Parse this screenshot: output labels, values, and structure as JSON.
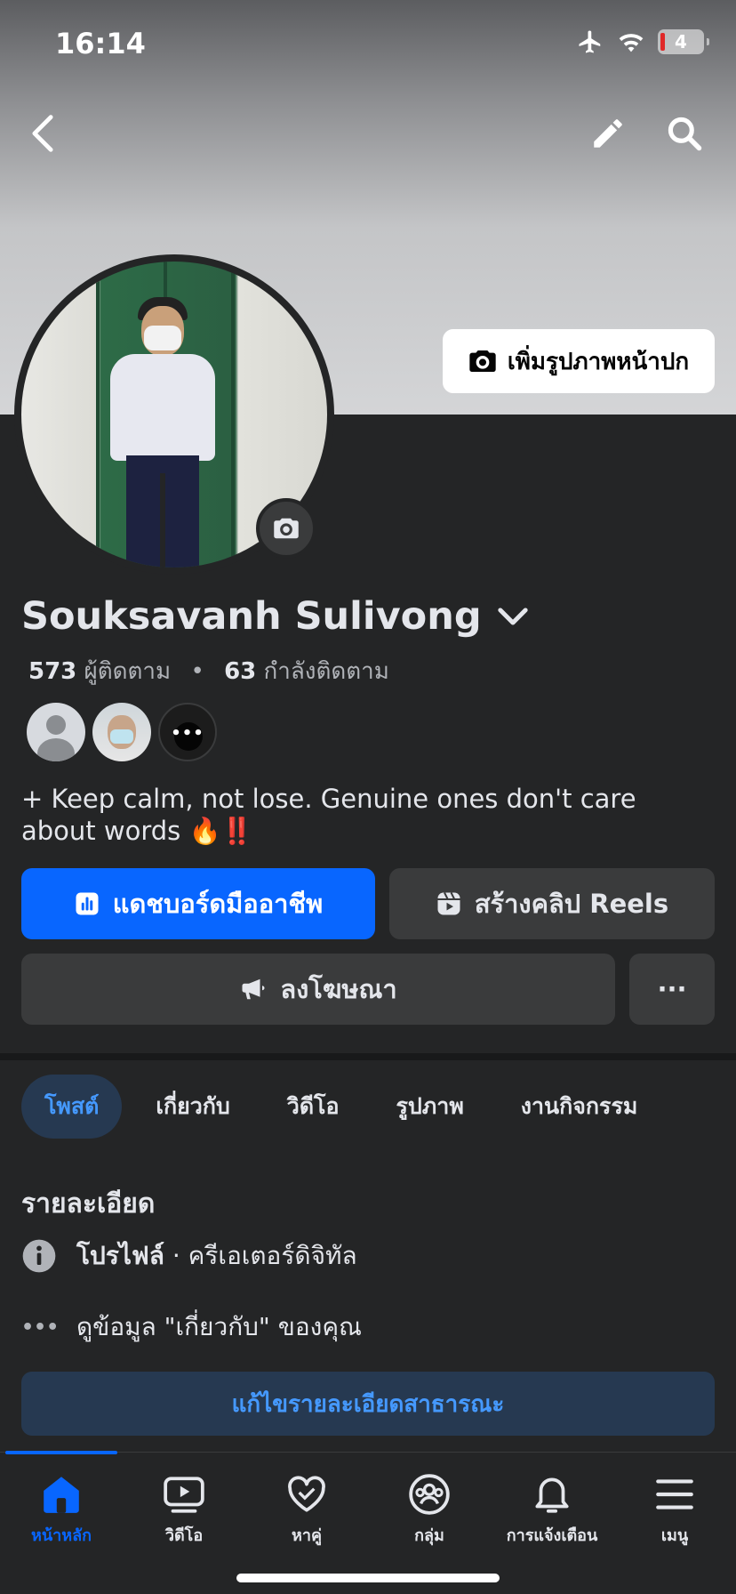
{
  "status_bar": {
    "time": "16:14",
    "battery": "4"
  },
  "cover": {
    "add_cover_label": "เพิ่มรูปภาพหน้าปก"
  },
  "profile": {
    "name": "Souksavanh Sulivong",
    "followers_count": "573",
    "followers_label": "ผู้ติดตาม",
    "following_count": "63",
    "following_label": "กำลังติดตาม",
    "bio": "+ Keep calm, not lose.  Genuine ones don't care about words 🔥‼️"
  },
  "actions": {
    "dashboard_label": "แดชบอร์ดมืออาชีพ",
    "reels_label": "สร้างคลิป Reels",
    "advertise_label": "ลงโฆษณา",
    "more_label": "···"
  },
  "tabs": [
    {
      "label": "โพสต์",
      "active": true
    },
    {
      "label": "เกี่ยวกับ",
      "active": false
    },
    {
      "label": "วิดีโอ",
      "active": false
    },
    {
      "label": "รูปภาพ",
      "active": false
    },
    {
      "label": "งานกิจกรรม",
      "active": false
    }
  ],
  "details": {
    "title": "รายละเอียด",
    "profile_label": "โปรไฟล์",
    "profile_sep": " · ",
    "profile_category": "ครีเอเตอร์ดิจิทัล",
    "see_about": "ดูข้อมูล \"เกี่ยวกับ\" ของคุณ",
    "edit_button": "แก้ไขรายละเอียดสาธารณะ"
  },
  "bottom_nav": [
    {
      "label": "หน้าหลัก",
      "icon": "home-icon",
      "active": true
    },
    {
      "label": "วิดีโอ",
      "icon": "video-icon",
      "active": false
    },
    {
      "label": "หาคู่",
      "icon": "dating-heart-icon",
      "active": false
    },
    {
      "label": "กลุ่ม",
      "icon": "groups-icon",
      "active": false
    },
    {
      "label": "การแจ้งเตือน",
      "icon": "bell-icon",
      "active": false
    },
    {
      "label": "เมนู",
      "icon": "menu-icon",
      "active": false
    }
  ],
  "colors": {
    "accent": "#0866ff",
    "background": "#242526",
    "tab_active_bg": "#263951"
  }
}
